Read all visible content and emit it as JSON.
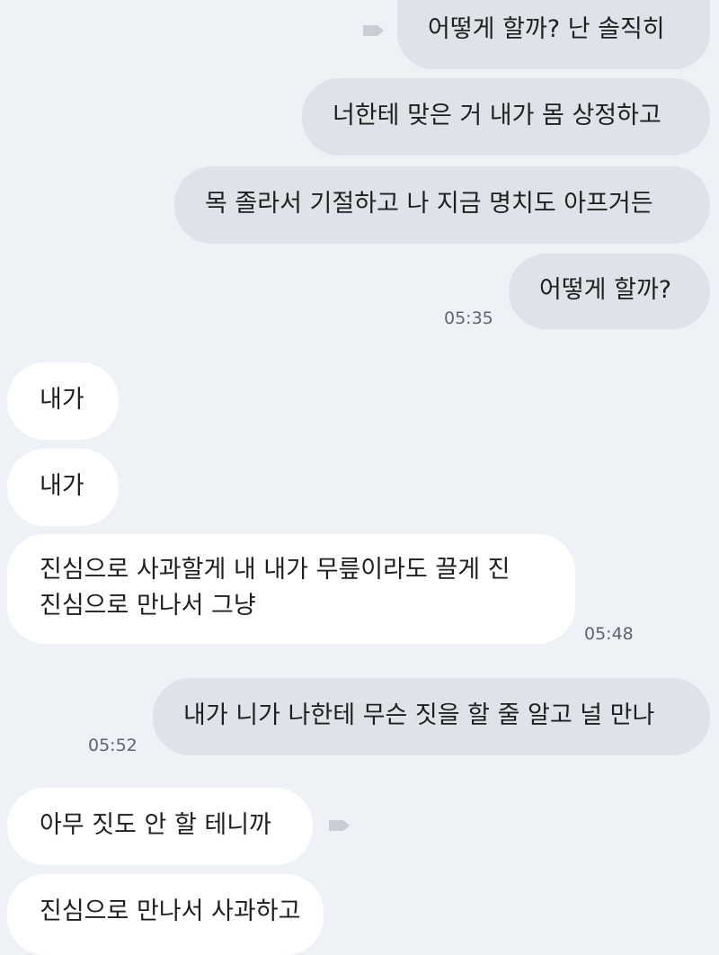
{
  "messages": [
    {
      "text": "어떻게 할까? 난 솔직히"
    },
    {
      "text": "너한테 맞은 거 내가 몸 상정하고"
    },
    {
      "text": "목 졸라서 기절하고 나 지금 명치도 아프거든"
    },
    {
      "text": "어떻게 할까?"
    },
    {
      "time": "05:35"
    },
    {
      "text": "내가"
    },
    {
      "text": "내가"
    },
    {
      "text_line1": "진심으로 사과할게 내 내가 무릎이라도 끌게 진",
      "text_line2": "진심으로 만나서 그냥"
    },
    {
      "time": "05:48"
    },
    {
      "text": "내가 니가 나한테 무슨 짓을 할 줄 알고 널 만나"
    },
    {
      "time": "05:52"
    },
    {
      "text": "아무 짓도 안 할 테니까"
    },
    {
      "text": "진심으로 만나서 사과하고"
    }
  ],
  "icons": {
    "message_tag": "tag-icon"
  },
  "colors": {
    "background": "#eef1f5",
    "outgoing_bubble": "#dfe3e9",
    "incoming_bubble": "#ffffff",
    "text": "#1f1f1f",
    "timestamp": "#5f6570"
  }
}
